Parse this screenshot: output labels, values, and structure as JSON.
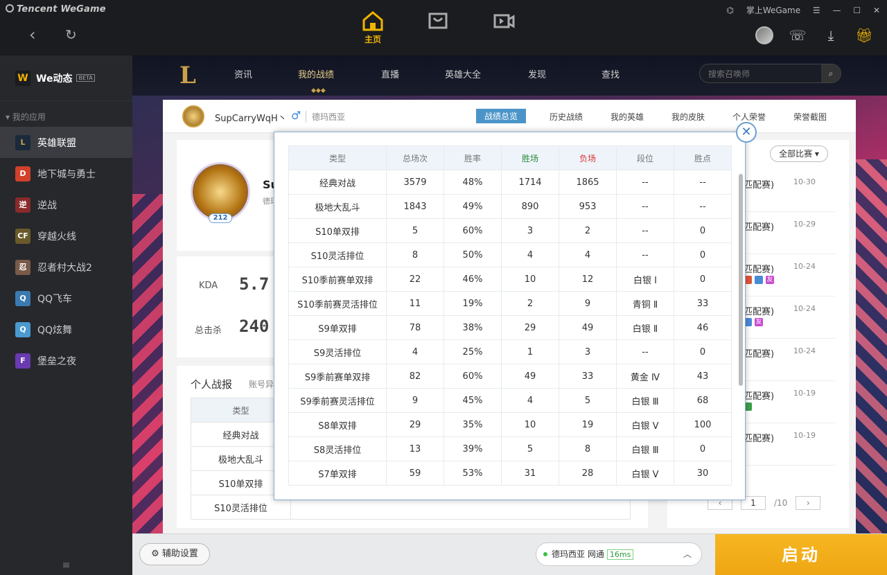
{
  "app": {
    "brand": "Tencent WeGame"
  },
  "topnav": {
    "home_label": "主页"
  },
  "wincontrols": {
    "mobile_label": "掌上WeGame"
  },
  "sidebar": {
    "title": "We动态",
    "beta": "BETA",
    "section": "我的应用",
    "items": [
      {
        "label": "英雄联盟",
        "icon": "lol-icon",
        "color": "#1b2a3a"
      },
      {
        "label": "地下城与勇士",
        "icon": "dnf-icon",
        "color": "#d0402a"
      },
      {
        "label": "逆战",
        "icon": "nizhan-icon",
        "color": "#8a2a2a"
      },
      {
        "label": "穿越火线",
        "icon": "cf-icon",
        "color": "#6a5a2a"
      },
      {
        "label": "忍者村大战2",
        "icon": "ninja-icon",
        "color": "#7a5a4a"
      },
      {
        "label": "QQ飞车",
        "icon": "qqspeed-icon",
        "color": "#3a7ab0"
      },
      {
        "label": "QQ炫舞",
        "icon": "qqdance-icon",
        "color": "#4a9ad0"
      },
      {
        "label": "堡垒之夜",
        "icon": "fortnite-icon",
        "color": "#6a3ab0"
      }
    ]
  },
  "lol_nav": {
    "items": [
      "资讯",
      "我的战绩",
      "直播",
      "英雄大全",
      "发现",
      "查找"
    ],
    "search_placeholder": "搜索召唤师"
  },
  "profile": {
    "name": "SupCarryWqH丶",
    "server": "德玛西亚",
    "level": "212",
    "name_short": "Su",
    "server_short": "德玛"
  },
  "profile_tabs": [
    "战绩总览",
    "历史战绩",
    "我的英雄",
    "我的皮肤",
    "个人荣誉",
    "荣誉截图"
  ],
  "stats": {
    "kda_label": "KDA",
    "kda_value": "5.7",
    "kills_label": "总击杀",
    "kills_value": "240"
  },
  "report": {
    "title": "个人战报",
    "account_label": "账号异",
    "header": "类型",
    "rows": [
      "经典对战",
      "极地大乱斗",
      "S10单双排",
      "S10灵活排位"
    ]
  },
  "history": {
    "filter": "全部比赛",
    "rows": [
      {
        "mode": "匹配赛)",
        "date": "10-30"
      },
      {
        "mode": "匹配赛)",
        "date": "10-29"
      },
      {
        "mode": "匹配赛)",
        "date": "10-24"
      },
      {
        "mode": "匹配赛)",
        "date": "10-24"
      },
      {
        "mode": "匹配赛)",
        "date": "10-24"
      },
      {
        "mode": "匹配赛)",
        "date": "10-19"
      },
      {
        "mode": "匹配赛)",
        "date": "10-19"
      }
    ],
    "tag_friend": "友",
    "page": "1",
    "total": "/10"
  },
  "popup": {
    "headers": [
      "类型",
      "总场次",
      "胜率",
      "胜场",
      "负场",
      "段位",
      "胜点"
    ],
    "rows": [
      [
        "经典对战",
        "3579",
        "48%",
        "1714",
        "1865",
        "--",
        "--"
      ],
      [
        "极地大乱斗",
        "1843",
        "49%",
        "890",
        "953",
        "--",
        "--"
      ],
      [
        "S10单双排",
        "5",
        "60%",
        "3",
        "2",
        "--",
        "0"
      ],
      [
        "S10灵活排位",
        "8",
        "50%",
        "4",
        "4",
        "--",
        "0"
      ],
      [
        "S10季前赛单双排",
        "22",
        "46%",
        "10",
        "12",
        "白银 Ⅰ",
        "0"
      ],
      [
        "S10季前赛灵活排位",
        "11",
        "19%",
        "2",
        "9",
        "青铜 Ⅱ",
        "33"
      ],
      [
        "S9单双排",
        "78",
        "38%",
        "29",
        "49",
        "白银 Ⅱ",
        "46"
      ],
      [
        "S9灵活排位",
        "4",
        "25%",
        "1",
        "3",
        "--",
        "0"
      ],
      [
        "S9季前赛单双排",
        "82",
        "60%",
        "49",
        "33",
        "黄金 Ⅳ",
        "43"
      ],
      [
        "S9季前赛灵活排位",
        "9",
        "45%",
        "4",
        "5",
        "白银 Ⅲ",
        "68"
      ],
      [
        "S8单双排",
        "29",
        "35%",
        "10",
        "19",
        "白银 Ⅴ",
        "100"
      ],
      [
        "S8灵活排位",
        "13",
        "39%",
        "5",
        "8",
        "白银 Ⅲ",
        "0"
      ],
      [
        "S7单双排",
        "59",
        "53%",
        "31",
        "28",
        "白银 Ⅴ",
        "30"
      ]
    ]
  },
  "bottom": {
    "assist": "辅助设置",
    "server": "德玛西亚",
    "network": "网通",
    "latency": "16ms",
    "launch": "启动"
  },
  "colors": {
    "accent": "#f0b400",
    "tab_active": "#4a94c8",
    "launch": "#f7b623"
  }
}
